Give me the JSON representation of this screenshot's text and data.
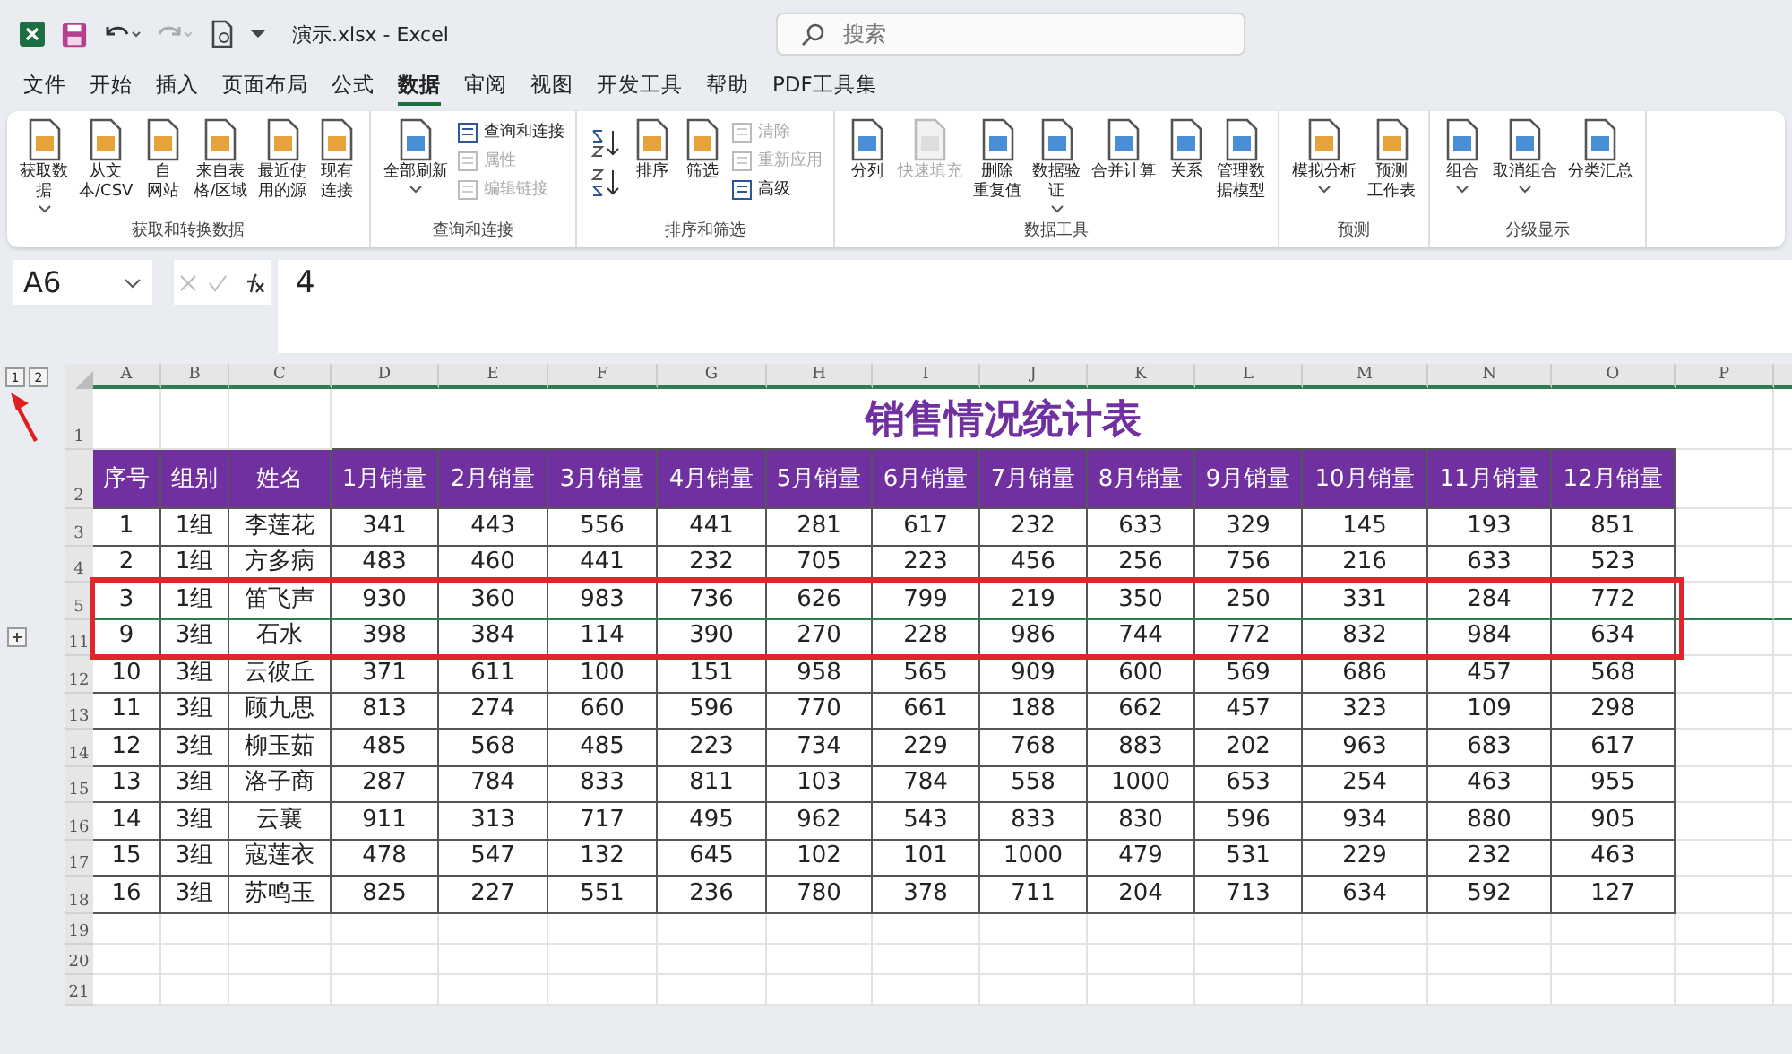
{
  "title_bar": {
    "file_title": "演示.xlsx - Excel",
    "search": {
      "placeholder": "搜索"
    }
  },
  "menu_tabs": [
    {
      "label": "文件",
      "selected": false
    },
    {
      "label": "开始",
      "selected": false
    },
    {
      "label": "插入",
      "selected": false
    },
    {
      "label": "页面布局",
      "selected": false
    },
    {
      "label": "公式",
      "selected": false
    },
    {
      "label": "数据",
      "selected": true
    },
    {
      "label": "审阅",
      "selected": false
    },
    {
      "label": "视图",
      "selected": false
    },
    {
      "label": "开发工具",
      "selected": false
    },
    {
      "label": "帮助",
      "selected": false
    },
    {
      "label": "PDF工具集",
      "selected": false
    }
  ],
  "ribbon_groups": [
    {
      "label": "获取和转换数据",
      "commands": [
        {
          "kind": "large",
          "lines": [
            "获取数",
            "据"
          ],
          "has_menu": true,
          "disabled": false
        },
        {
          "kind": "large",
          "lines": [
            "从文",
            "本/CSV"
          ],
          "has_menu": false,
          "disabled": false
        },
        {
          "kind": "large",
          "lines": [
            "自",
            "网站"
          ],
          "has_menu": false,
          "disabled": false
        },
        {
          "kind": "large",
          "lines": [
            "来自表",
            "格/区域"
          ],
          "has_menu": false,
          "disabled": false
        },
        {
          "kind": "large",
          "lines": [
            "最近使",
            "用的源"
          ],
          "has_menu": false,
          "disabled": false
        },
        {
          "kind": "large",
          "lines": [
            "现有",
            "连接"
          ],
          "has_menu": false,
          "disabled": false
        }
      ]
    },
    {
      "label": "查询和连接",
      "commands": [
        {
          "kind": "large",
          "lines": [
            "全部刷新"
          ],
          "has_menu": true,
          "disabled": false
        },
        {
          "kind": "small",
          "label": "查询和连接",
          "disabled": false
        },
        {
          "kind": "small",
          "label": "属性",
          "disabled": true
        },
        {
          "kind": "small",
          "label": "编辑链接",
          "disabled": true
        }
      ]
    },
    {
      "label": "排序和筛选",
      "commands": [
        {
          "kind": "sort_pair"
        },
        {
          "kind": "large",
          "lines": [
            "排序"
          ],
          "has_menu": false,
          "disabled": false
        },
        {
          "kind": "large",
          "lines": [
            "筛选"
          ],
          "has_menu": false,
          "disabled": false
        },
        {
          "kind": "small",
          "label": "清除",
          "disabled": true
        },
        {
          "kind": "small",
          "label": "重新应用",
          "disabled": true
        },
        {
          "kind": "small",
          "label": "高级",
          "disabled": false
        }
      ]
    },
    {
      "label": "数据工具",
      "commands": [
        {
          "kind": "large",
          "lines": [
            "分列"
          ],
          "has_menu": false,
          "disabled": false
        },
        {
          "kind": "large",
          "lines": [
            "快速填充"
          ],
          "has_menu": false,
          "disabled": true
        },
        {
          "kind": "large",
          "lines": [
            "删除",
            "重复值"
          ],
          "has_menu": false,
          "disabled": false
        },
        {
          "kind": "large",
          "lines": [
            "数据验",
            "证"
          ],
          "has_menu": true,
          "disabled": false
        },
        {
          "kind": "large",
          "lines": [
            "合并计算"
          ],
          "has_menu": false,
          "disabled": false
        },
        {
          "kind": "large",
          "lines": [
            "关系"
          ],
          "has_menu": false,
          "disabled": false
        },
        {
          "kind": "large",
          "lines": [
            "管理数",
            "据模型"
          ],
          "has_menu": false,
          "disabled": false
        }
      ]
    },
    {
      "label": "预测",
      "commands": [
        {
          "kind": "large",
          "lines": [
            "模拟分析"
          ],
          "has_menu": true,
          "disabled": false
        },
        {
          "kind": "large",
          "lines": [
            "预测",
            "工作表"
          ],
          "has_menu": false,
          "disabled": false
        }
      ]
    },
    {
      "label": "分级显示",
      "commands": [
        {
          "kind": "large",
          "lines": [
            "组合"
          ],
          "has_menu": true,
          "disabled": false
        },
        {
          "kind": "large",
          "lines": [
            "取消组合"
          ],
          "has_menu": true,
          "disabled": false
        },
        {
          "kind": "large",
          "lines": [
            "分类汇总"
          ],
          "has_menu": false,
          "disabled": false
        }
      ]
    }
  ],
  "formula_bar": {
    "name_box": "A6",
    "value": "4"
  },
  "outline_levels": [
    "1",
    "2"
  ],
  "columns": [
    "A",
    "B",
    "C",
    "D",
    "E",
    "F",
    "G",
    "H",
    "I",
    "J",
    "K",
    "L",
    "M",
    "N",
    "O",
    "P"
  ],
  "sheet": {
    "title_row": "1",
    "title": "销售情况统计表",
    "header_row": "2",
    "headers": [
      "序号",
      "组别",
      "姓名",
      "1月销量",
      "2月销量",
      "3月销量",
      "4月销量",
      "5月销量",
      "6月销量",
      "7月销量",
      "8月销量",
      "9月销量",
      "10月销量",
      "11月销量",
      "12月销量"
    ],
    "rows": [
      {
        "row_number": "3",
        "collapsed_after": false,
        "cells": [
          "1",
          "1组",
          "李莲花",
          "341",
          "443",
          "556",
          "441",
          "281",
          "617",
          "232",
          "633",
          "329",
          "145",
          "193",
          "851"
        ]
      },
      {
        "row_number": "4",
        "collapsed_after": false,
        "cells": [
          "2",
          "1组",
          "方多病",
          "483",
          "460",
          "441",
          "232",
          "705",
          "223",
          "456",
          "256",
          "756",
          "216",
          "633",
          "523"
        ]
      },
      {
        "row_number": "5",
        "collapsed_after": true,
        "cells": [
          "3",
          "1组",
          "笛飞声",
          "930",
          "360",
          "983",
          "736",
          "626",
          "799",
          "219",
          "350",
          "250",
          "331",
          "284",
          "772"
        ]
      },
      {
        "row_number": "11",
        "collapsed_after": false,
        "cells": [
          "9",
          "3组",
          "石水",
          "398",
          "384",
          "114",
          "390",
          "270",
          "228",
          "986",
          "744",
          "772",
          "832",
          "984",
          "634"
        ]
      },
      {
        "row_number": "12",
        "collapsed_after": false,
        "cells": [
          "10",
          "3组",
          "云彼丘",
          "371",
          "611",
          "100",
          "151",
          "958",
          "565",
          "909",
          "600",
          "569",
          "686",
          "457",
          "568"
        ]
      },
      {
        "row_number": "13",
        "collapsed_after": false,
        "cells": [
          "11",
          "3组",
          "顾九思",
          "813",
          "274",
          "660",
          "596",
          "770",
          "661",
          "188",
          "662",
          "457",
          "323",
          "109",
          "298"
        ]
      },
      {
        "row_number": "14",
        "collapsed_after": false,
        "cells": [
          "12",
          "3组",
          "柳玉茹",
          "485",
          "568",
          "485",
          "223",
          "734",
          "229",
          "768",
          "883",
          "202",
          "963",
          "683",
          "617"
        ]
      },
      {
        "row_number": "15",
        "collapsed_after": false,
        "cells": [
          "13",
          "3组",
          "洛子商",
          "287",
          "784",
          "833",
          "811",
          "103",
          "784",
          "558",
          "1000",
          "653",
          "254",
          "463",
          "955"
        ]
      },
      {
        "row_number": "16",
        "collapsed_after": false,
        "cells": [
          "14",
          "3组",
          "云襄",
          "911",
          "313",
          "717",
          "495",
          "962",
          "543",
          "833",
          "830",
          "596",
          "934",
          "880",
          "905"
        ]
      },
      {
        "row_number": "17",
        "collapsed_after": false,
        "cells": [
          "15",
          "3组",
          "寇莲衣",
          "478",
          "547",
          "132",
          "645",
          "102",
          "101",
          "1000",
          "479",
          "531",
          "229",
          "232",
          "463"
        ]
      },
      {
        "row_number": "18",
        "collapsed_after": false,
        "cells": [
          "16",
          "3组",
          "苏鸣玉",
          "825",
          "227",
          "551",
          "236",
          "780",
          "378",
          "711",
          "204",
          "713",
          "634",
          "592",
          "127"
        ]
      }
    ],
    "empty_rows": [
      "19",
      "20",
      "21"
    ]
  }
}
